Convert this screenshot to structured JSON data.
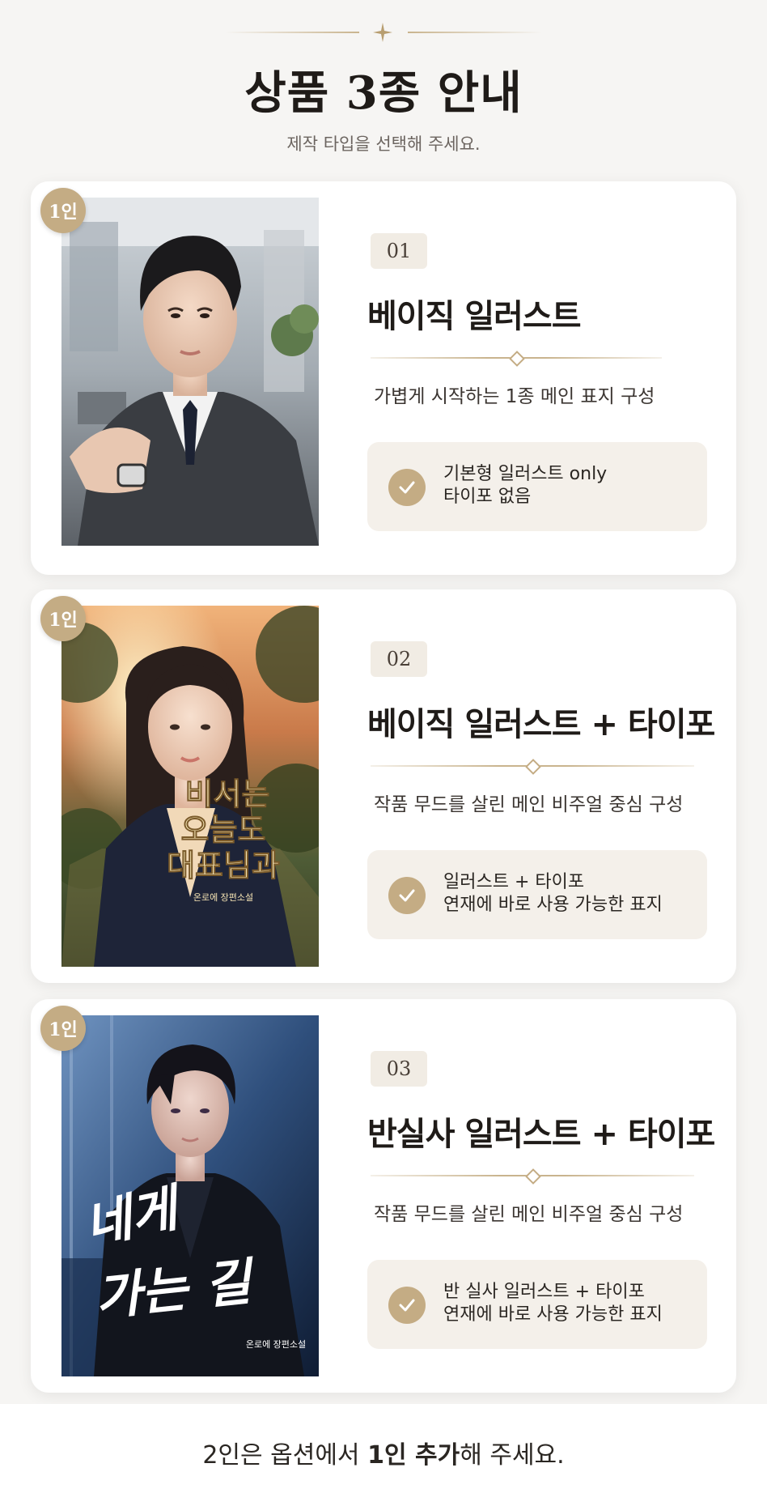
{
  "header": {
    "title": "상품 3종 안내",
    "subtitle": "제작 타입을 선택해 주세요."
  },
  "products": [
    {
      "badge": "1인",
      "number": "01",
      "title": "베이직 일러스트",
      "description": "가볍게 시작하는 1종 메인 표지 구성",
      "feature_line1": "기본형 일러스트 only",
      "feature_line2": "타이포 없음",
      "cover_icon": "male-portrait-illustration"
    },
    {
      "badge": "1인",
      "number": "02",
      "title": "베이직 일러스트 + 타이포",
      "description": "작품 무드를 살린 메인 비주얼 중심 구성",
      "feature_line1": "일러스트 + 타이포",
      "feature_line2": "연재에 바로 사용 가능한 표지",
      "cover_title_line1": "비서는",
      "cover_title_line2": "오늘도",
      "cover_title_line3": "대표님과",
      "cover_author": "온로에 장편소설",
      "cover_icon": "female-portrait-illustration"
    },
    {
      "badge": "1인",
      "number": "03",
      "title": "반실사 일러스트 + 타이포",
      "description": "작품 무드를 살린 메인 비주얼 중심 구성",
      "feature_line1": "반 실사 일러스트 + 타이포",
      "feature_line2": "연재에 바로 사용 가능한 표지",
      "cover_title_line1": "네게",
      "cover_title_line2": "가는 길",
      "cover_author": "온로에 장편소설",
      "cover_icon": "semi-realistic-male-portrait"
    }
  ],
  "footer": {
    "text_before": "2인은 옵션에서 ",
    "text_bold": "1인 추가",
    "text_after": "해 주세요."
  },
  "colors": {
    "accent_gold": "#c4ac84",
    "background": "#f6f5f3",
    "feature_bg": "#f4f0ea"
  }
}
